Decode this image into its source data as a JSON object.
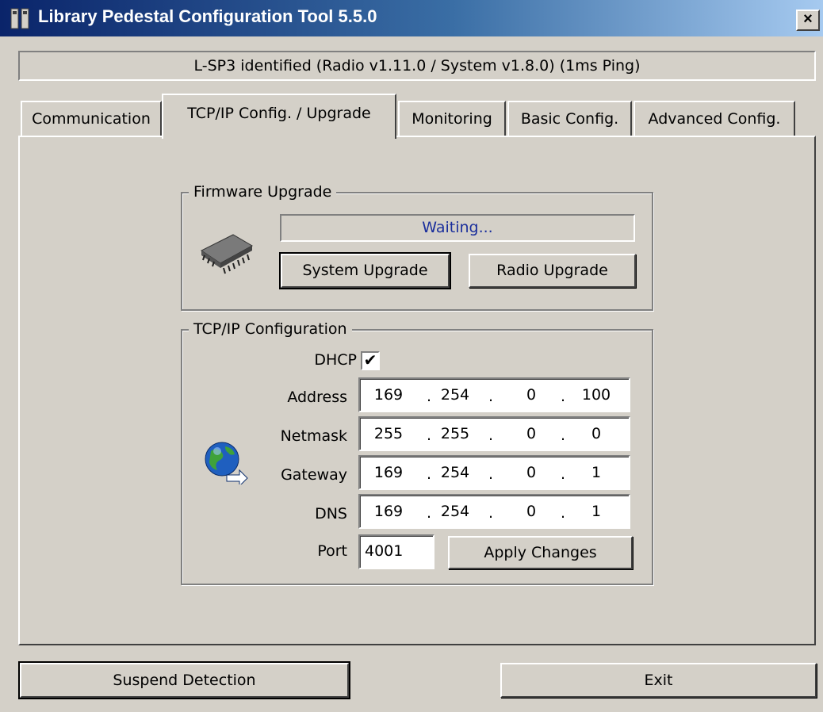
{
  "window": {
    "title": "Library Pedestal Configuration Tool 5.5.0",
    "close_glyph": "×"
  },
  "status_text": "L-SP3 identified (Radio v1.11.0 / System v1.8.0) (1ms Ping)",
  "tabs": [
    {
      "label": "Communication",
      "active": false
    },
    {
      "label": "TCP/IP Config. / Upgrade",
      "active": true
    },
    {
      "label": "Monitoring",
      "active": false
    },
    {
      "label": "Basic Config.",
      "active": false
    },
    {
      "label": "Advanced Config.",
      "active": false
    }
  ],
  "firmware": {
    "group_label": "Firmware Upgrade",
    "icon": "chip-icon",
    "progress_text": "Waiting...",
    "system_upgrade_label": "System Upgrade",
    "radio_upgrade_label": "Radio Upgrade"
  },
  "tcpip": {
    "group_label": "TCP/IP Configuration",
    "icon": "network-globe-icon",
    "dhcp_label": "DHCP",
    "dhcp_checked": true,
    "check_glyph": "✔",
    "address_label": "Address",
    "address": [
      "169",
      "254",
      "0",
      "100"
    ],
    "netmask_label": "Netmask",
    "netmask": [
      "255",
      "255",
      "0",
      "0"
    ],
    "gateway_label": "Gateway",
    "gateway": [
      "169",
      "254",
      "0",
      "1"
    ],
    "dns_label": "DNS",
    "dns": [
      "169",
      "254",
      "0",
      "1"
    ],
    "port_label": "Port",
    "port_value": "4001",
    "apply_label": "Apply Changes"
  },
  "footer": {
    "suspend_label": "Suspend Detection",
    "exit_label": "Exit"
  }
}
